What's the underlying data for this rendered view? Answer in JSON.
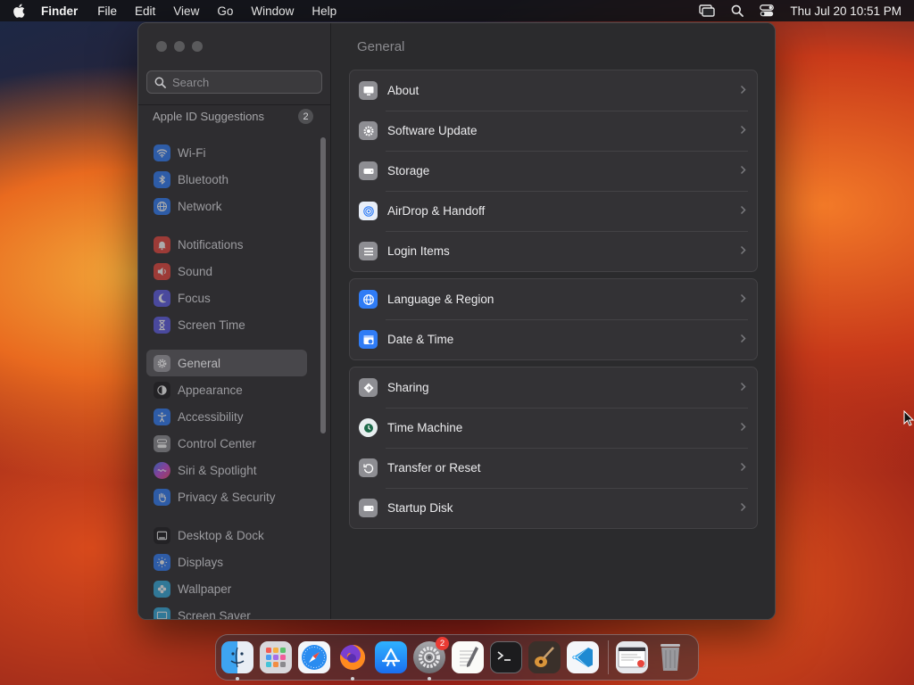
{
  "menubar": {
    "app_name": "Finder",
    "menus": [
      "File",
      "Edit",
      "View",
      "Go",
      "Window",
      "Help"
    ],
    "clock": "Thu Jul 20  10:51 PM",
    "status_icons": [
      "screen-mirroring-icon",
      "spotlight-search-icon",
      "control-center-icon"
    ]
  },
  "sidebar": {
    "search_placeholder": "Search",
    "apple_id": {
      "label": "Apple ID Suggestions",
      "count": "2"
    },
    "items": [
      {
        "label": "Wi-Fi",
        "icon": "wifi-icon",
        "color": "#2f7cf6"
      },
      {
        "label": "Bluetooth",
        "icon": "bluetooth-icon",
        "color": "#2f7cf6"
      },
      {
        "label": "Network",
        "icon": "globe-icon",
        "color": "#2f7cf6"
      },
      {
        "label": "Notifications",
        "icon": "bell-icon",
        "color": "#e8453c"
      },
      {
        "label": "Sound",
        "icon": "speaker-icon",
        "color": "#e8453c"
      },
      {
        "label": "Focus",
        "icon": "moon-icon",
        "color": "#5e5ce6"
      },
      {
        "label": "Screen Time",
        "icon": "hourglass-icon",
        "color": "#5e5ce6"
      },
      {
        "label": "General",
        "icon": "gear-icon",
        "color": "#8e8e93",
        "selected": true
      },
      {
        "label": "Appearance",
        "icon": "appearance-icon",
        "color": "#1c1c1e"
      },
      {
        "label": "Accessibility",
        "icon": "accessibility-icon",
        "color": "#2f7cf6"
      },
      {
        "label": "Control Center",
        "icon": "control-center-icon",
        "color": "#8e8e93"
      },
      {
        "label": "Siri & Spotlight",
        "icon": "siri-icon",
        "color": "#b04fe0"
      },
      {
        "label": "Privacy & Security",
        "icon": "hand-icon",
        "color": "#2f7cf6"
      },
      {
        "label": "Desktop & Dock",
        "icon": "dock-icon",
        "color": "#1c1c1e"
      },
      {
        "label": "Displays",
        "icon": "sun-icon",
        "color": "#2f7cf6"
      },
      {
        "label": "Wallpaper",
        "icon": "flower-icon",
        "color": "#34aadc"
      },
      {
        "label": "Screen Saver",
        "icon": "screen-saver-icon",
        "color": "#34aadc"
      }
    ]
  },
  "main": {
    "title": "General",
    "groups": [
      [
        {
          "label": "About",
          "icon": "display-icon",
          "color": "#8e8e93"
        },
        {
          "label": "Software Update",
          "icon": "gear-badge-icon",
          "color": "#8e8e93"
        },
        {
          "label": "Storage",
          "icon": "drive-icon",
          "color": "#8e8e93"
        },
        {
          "label": "AirDrop & Handoff",
          "icon": "airdrop-icon",
          "color": "#e8eef8"
        },
        {
          "label": "Login Items",
          "icon": "list-icon",
          "color": "#8e8e93"
        }
      ],
      [
        {
          "label": "Language & Region",
          "icon": "globe-icon",
          "color": "#2f7cf6"
        },
        {
          "label": "Date & Time",
          "icon": "calendar-clock-icon",
          "color": "#2f7cf6"
        }
      ],
      [
        {
          "label": "Sharing",
          "icon": "sharing-icon",
          "color": "#8e8e93"
        },
        {
          "label": "Time Machine",
          "icon": "time-machine-icon",
          "color": "#e8eef0"
        },
        {
          "label": "Transfer or Reset",
          "icon": "reset-icon",
          "color": "#8e8e93"
        },
        {
          "label": "Startup Disk",
          "icon": "drive-icon",
          "color": "#8e8e93"
        }
      ]
    ]
  },
  "dock": {
    "apps": [
      {
        "name": "finder",
        "running": true
      },
      {
        "name": "launchpad",
        "running": false
      },
      {
        "name": "safari",
        "running": false
      },
      {
        "name": "firefox",
        "running": true
      },
      {
        "name": "app-store",
        "running": false
      },
      {
        "name": "system-settings",
        "running": true,
        "badge": "2"
      },
      {
        "name": "textedit",
        "running": false
      },
      {
        "name": "terminal",
        "running": false
      },
      {
        "name": "instruments",
        "running": false
      },
      {
        "name": "vscode",
        "running": false
      }
    ]
  }
}
